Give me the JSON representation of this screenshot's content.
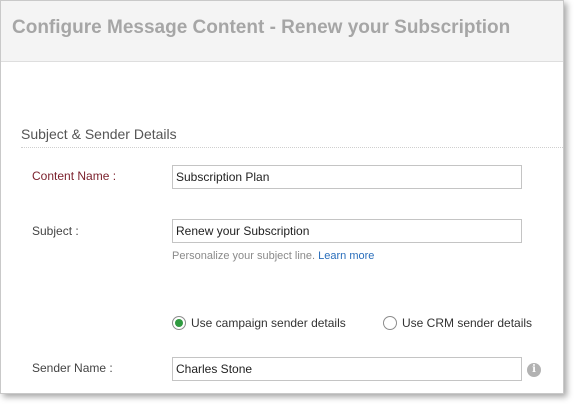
{
  "header": {
    "title": "Configure Message Content - Renew your Subscription"
  },
  "section": {
    "title": "Subject & Sender Details"
  },
  "content_name": {
    "label": "Content Name :",
    "value": "Subscription Plan"
  },
  "subject": {
    "label": "Subject :",
    "value": "Renew your Subscription",
    "hint": "Personalize your subject line.",
    "learn_more": "Learn more"
  },
  "sender_options": {
    "selected": "campaign",
    "options": [
      {
        "id": "campaign",
        "label": "Use campaign sender details",
        "checked": true
      },
      {
        "id": "crm",
        "label": "Use CRM sender details",
        "checked": false
      }
    ]
  },
  "sender_name": {
    "label": "Sender Name :",
    "value": "Charles Stone",
    "info_icon": "info-icon",
    "info_glyph": "i"
  },
  "colors": {
    "accent_label": "#7a1f2b",
    "radio_selected": "#2f9a3f",
    "link": "#2a6ebb",
    "header_title": "#a6a6a6"
  }
}
